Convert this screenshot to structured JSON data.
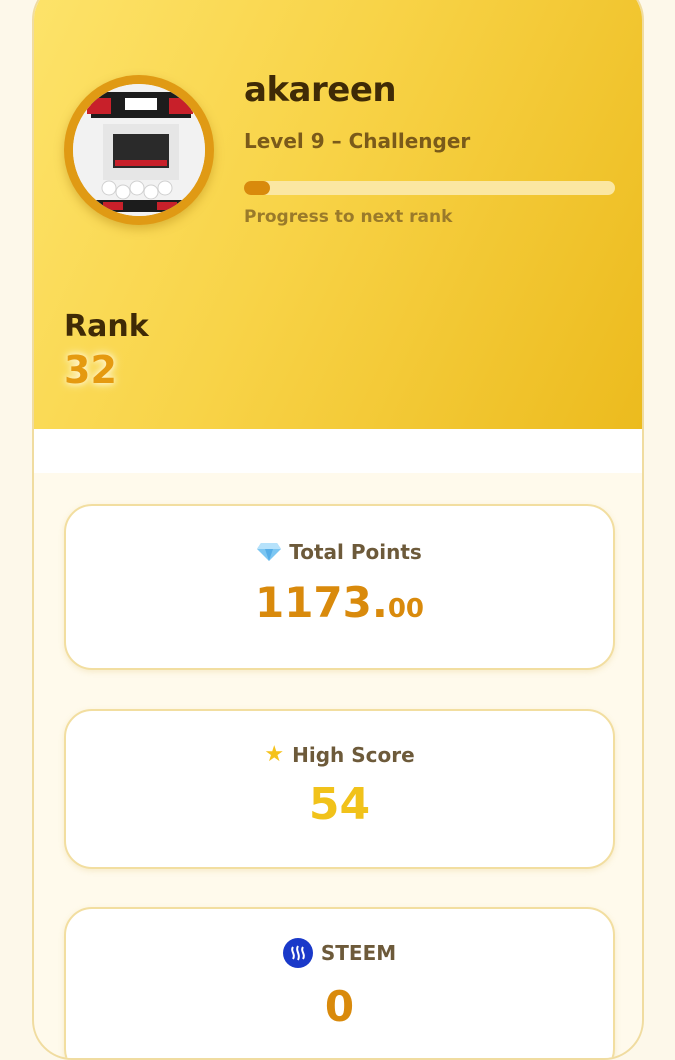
{
  "profile": {
    "username": "akareen",
    "level": "Level 9 – Challenger",
    "progress_caption": "Progress to next rank",
    "progress_fraction": 0.07,
    "rank_label": "Rank",
    "rank_value": "32"
  },
  "stats": {
    "total_points": {
      "icon": "gem-icon",
      "label": "Total Points",
      "value_main": "1173.",
      "value_decimals": "00"
    },
    "high_score": {
      "icon": "star-icon",
      "label": "High Score",
      "value": "54"
    },
    "steem": {
      "icon": "steem-icon",
      "label": "STEEM",
      "value": "0"
    }
  },
  "colors": {
    "header_gradient_start": "#fde36a",
    "header_gradient_end": "#ecbb1e",
    "accent_orange": "#d98a0c",
    "accent_yellow": "#f5c21b",
    "steem_blue": "#1a39c9"
  }
}
